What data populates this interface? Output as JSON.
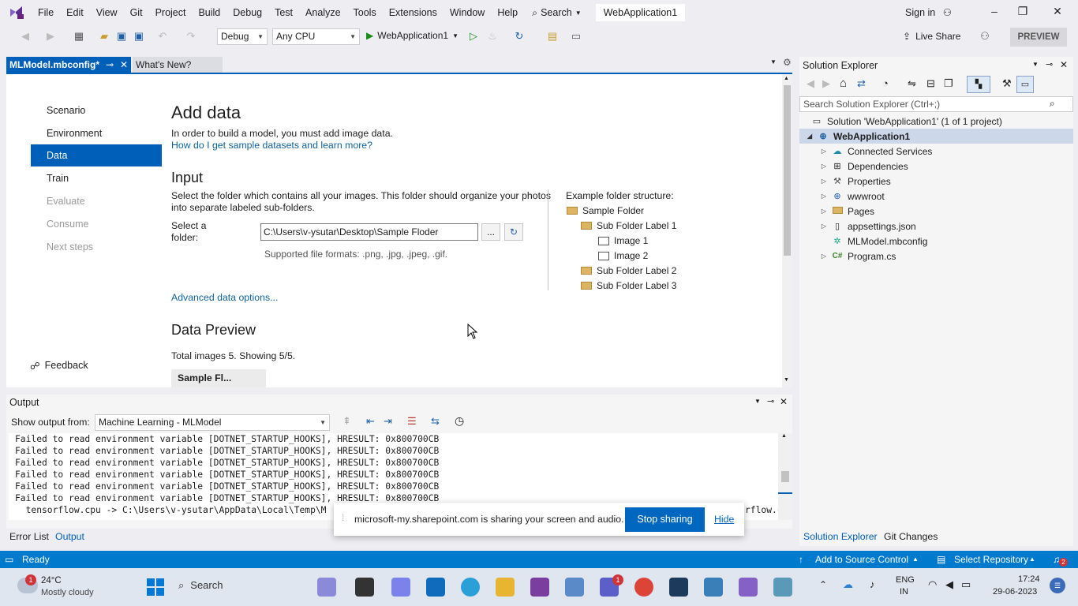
{
  "menubar": {
    "items": [
      "File",
      "Edit",
      "View",
      "Git",
      "Project",
      "Build",
      "Debug",
      "Test",
      "Analyze",
      "Tools",
      "Extensions",
      "Window",
      "Help"
    ],
    "search_label": "Search",
    "solution_title": "WebApplication1",
    "signin_label": "Sign in"
  },
  "toolbar": {
    "config": "Debug",
    "platform": "Any CPU",
    "run_target": "WebApplication1",
    "live_share": "Live Share",
    "preview": "PREVIEW"
  },
  "tabs": {
    "active": "MLModel.mbconfig*",
    "second": "What's New?"
  },
  "steps": [
    {
      "label": "Scenario",
      "state": "normal"
    },
    {
      "label": "Environment",
      "state": "normal"
    },
    {
      "label": "Data",
      "state": "active"
    },
    {
      "label": "Train",
      "state": "normal"
    },
    {
      "label": "Evaluate",
      "state": "disabled"
    },
    {
      "label": "Consume",
      "state": "disabled"
    },
    {
      "label": "Next steps",
      "state": "disabled"
    }
  ],
  "feedback": "Feedback",
  "content": {
    "title": "Add data",
    "intro": "In order to build a model, you must add image data.",
    "help_link": "How do I get sample datasets and learn more?",
    "input_heading": "Input",
    "input_desc_1": "Select the folder which contains all your images. This folder should organize your photos",
    "input_desc_2": "into separate labeled sub-folders.",
    "select_label_1": "Select a",
    "select_label_2": "folder:",
    "folder_path": "C:\\Users\\v-ysutar\\Desktop\\Sample Floder",
    "browse_label": "...",
    "formats": "Supported file formats: .png, .jpg, .jpeg, .gif.",
    "advanced_link": "Advanced data options...",
    "example_heading": "Example folder structure:",
    "example_tree": [
      "Sample Folder",
      "Sub Folder Label 1",
      "Image 1",
      "Image 2",
      "Sub Folder Label 2",
      "Sub Folder Label 3"
    ],
    "preview_heading": "Data Preview",
    "preview_count": "Total images 5. Showing 5/5.",
    "preview_column": "Sample Fl..."
  },
  "output": {
    "title": "Output",
    "show_from_label": "Show output from:",
    "source": "Machine Learning - MLModel",
    "lines": [
      "Failed to read environment variable [DOTNET_STARTUP_HOOKS], HRESULT: 0x800700CB",
      "Failed to read environment variable [DOTNET_STARTUP_HOOKS], HRESULT: 0x800700CB",
      "Failed to read environment variable [DOTNET_STARTUP_HOOKS], HRESULT: 0x800700CB",
      "Failed to read environment variable [DOTNET_STARTUP_HOOKS], HRESULT: 0x800700CB",
      "Failed to read environment variable [DOTNET_STARTUP_HOOKS], HRESULT: 0x800700CB",
      "Failed to read environment variable [DOTNET_STARTUP_HOOKS], HRESULT: 0x800700CB"
    ],
    "last_line_left": "  tensorflow.cpu -> C:\\Users\\v-ysutar\\AppData\\Local\\Temp\\M",
    "last_line_right": "rflow.c",
    "bottom_tabs": [
      "Error List",
      "Output"
    ]
  },
  "solution_explorer": {
    "title": "Solution Explorer",
    "search_placeholder": "Search Solution Explorer (Ctrl+;)",
    "solution": "Solution 'WebApplication1' (1 of 1 project)",
    "project": "WebApplication1",
    "items": [
      "Connected Services",
      "Dependencies",
      "Properties",
      "wwwroot",
      "Pages",
      "appsettings.json",
      "MLModel.mbconfig",
      "Program.cs"
    ],
    "bottom_tabs": [
      "Solution Explorer",
      "Git Changes"
    ]
  },
  "statusbar": {
    "ready": "Ready",
    "add_source": "Add to Source Control",
    "select_repo": "Select Repository",
    "notif_count": "2"
  },
  "sharing": {
    "message": "microsoft-my.sharepoint.com is sharing your screen and audio.",
    "stop": "Stop sharing",
    "hide": "Hide"
  },
  "taskbar": {
    "weather_temp": "24°C",
    "weather_desc": "Mostly cloudy",
    "search": "Search",
    "lang_1": "ENG",
    "lang_2": "IN",
    "time": "17:24",
    "date": "29-06-2023",
    "badge": "1"
  },
  "colors": {
    "accent": "#005fb8",
    "status_bar": "#007acc",
    "link": "#0e639c"
  }
}
